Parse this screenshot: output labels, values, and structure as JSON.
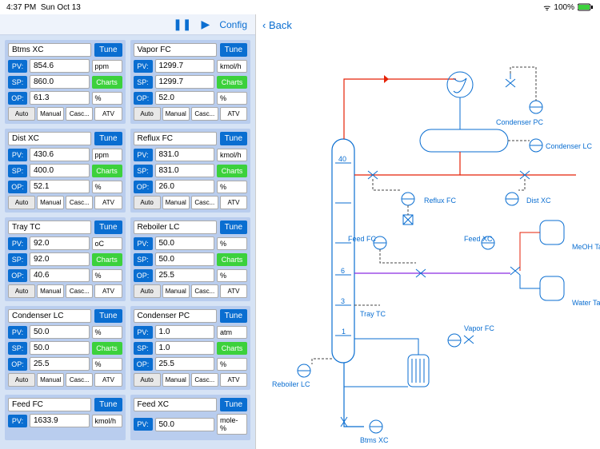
{
  "status": {
    "time": "4:37 PM",
    "date": "Sun Oct 13",
    "battery": "100%"
  },
  "toolbar": {
    "pause": "❚❚",
    "play": "▶",
    "config": "Config"
  },
  "back": "Back",
  "labels": {
    "pv": "PV:",
    "sp": "SP:",
    "op": "OP:",
    "tune": "Tune",
    "charts": "Charts"
  },
  "modes": [
    "Auto",
    "Manual",
    "Casc...",
    "ATV"
  ],
  "cards": [
    {
      "title": "Btms XC",
      "pv": "854.6",
      "sp": "860.0",
      "op": "61.3",
      "pv_unit": "ppm",
      "op_unit": "%"
    },
    {
      "title": "Vapor FC",
      "pv": "1299.7",
      "sp": "1299.7",
      "op": "52.0",
      "pv_unit": "kmol/h",
      "op_unit": "%"
    },
    {
      "title": "Dist XC",
      "pv": "430.6",
      "sp": "400.0",
      "op": "52.1",
      "pv_unit": "ppm",
      "op_unit": "%"
    },
    {
      "title": "Reflux FC",
      "pv": "831.0",
      "sp": "831.0",
      "op": "26.0",
      "pv_unit": "kmol/h",
      "op_unit": "%"
    },
    {
      "title": "Tray TC",
      "pv": "92.0",
      "sp": "92.0",
      "op": "40.6",
      "pv_unit": "oC",
      "op_unit": "%"
    },
    {
      "title": "Reboiler LC",
      "pv": "50.0",
      "sp": "50.0",
      "op": "25.5",
      "pv_unit": "%",
      "op_unit": "%"
    },
    {
      "title": "Condenser LC",
      "pv": "50.0",
      "sp": "50.0",
      "op": "25.5",
      "pv_unit": "%",
      "op_unit": "%"
    },
    {
      "title": "Condenser PC",
      "pv": "1.0",
      "sp": "1.0",
      "op": "25.5",
      "pv_unit": "atm",
      "op_unit": "%"
    },
    {
      "title": "Feed FC",
      "pv": "1633.9",
      "sp": "",
      "op": "",
      "pv_unit": "kmol/h",
      "op_unit": ""
    },
    {
      "title": "Feed XC",
      "pv": "50.0",
      "sp": "",
      "op": "",
      "pv_unit": "mole-%",
      "op_unit": ""
    }
  ],
  "diagram": {
    "column_ticks": [
      "40",
      "6",
      "3",
      "1"
    ],
    "labels": {
      "condenser_pc": "Condenser PC",
      "condenser_lc": "Condenser LC",
      "reflux_fc": "Reflux FC",
      "dist_xc": "Dist XC",
      "feed_fc": "Feed FC",
      "feed_xc": "Feed XC",
      "tray_tc": "Tray TC",
      "vapor_fc": "Vapor FC",
      "reboiler_lc": "Reboiler LC",
      "btms_xc": "Btms XC",
      "meoh_tank": "MeOH Tank",
      "water_tank": "Water Tank"
    }
  }
}
